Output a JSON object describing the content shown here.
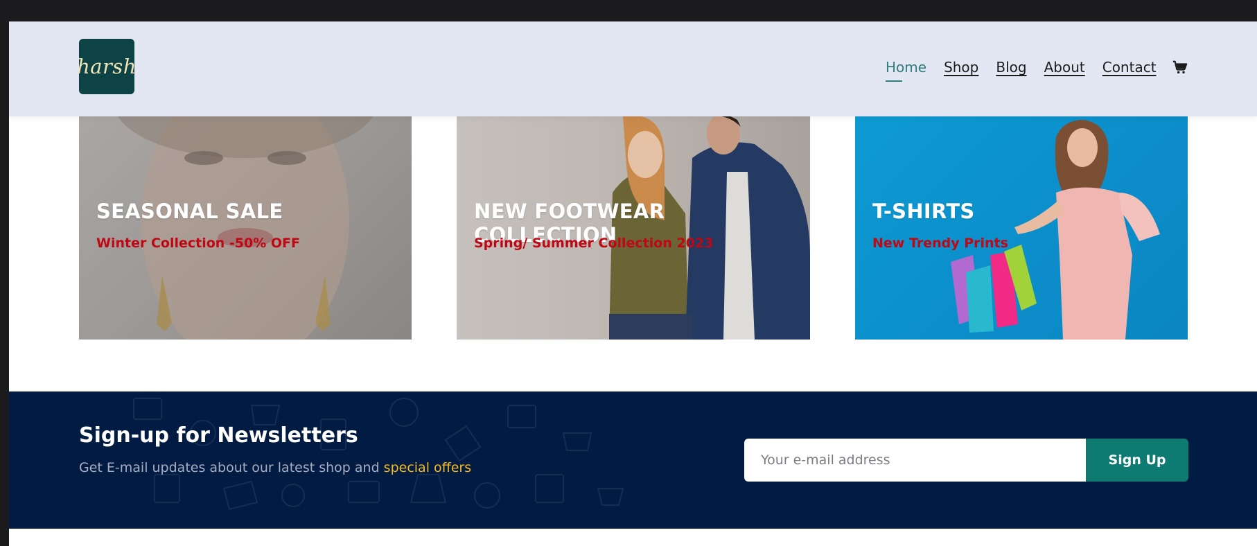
{
  "header": {
    "logo_text": "harsh",
    "nav": [
      {
        "label": "Home",
        "active": true
      },
      {
        "label": "Shop",
        "active": false
      },
      {
        "label": "Blog",
        "active": false
      },
      {
        "label": "About",
        "active": false
      },
      {
        "label": "Contact",
        "active": false
      }
    ],
    "cart_icon": "shopping-cart-icon"
  },
  "promos": [
    {
      "title": "SEASONAL SALE",
      "subtitle": "Winter Collection -50% OFF"
    },
    {
      "title": "NEW FOOTWEAR COLLECTION",
      "subtitle": "Spring/ Summer Collection 2023"
    },
    {
      "title": "T-SHIRTS",
      "subtitle": "New Trendy Prints"
    }
  ],
  "newsletter": {
    "title": "Sign-up for Newsletters",
    "text": "Get E-mail updates about our latest shop and ",
    "highlight": "special offers",
    "placeholder": "Your e-mail address",
    "button_label": "Sign Up"
  },
  "colors": {
    "header_bg": "#e3e7f3",
    "logo_bg": "#0e4346",
    "nav_active": "#2f7e7b",
    "promo_subtitle": "#c00714",
    "newsletter_bg": "#021b43",
    "highlight": "#f5b921",
    "button_bg": "#0e7b72"
  }
}
